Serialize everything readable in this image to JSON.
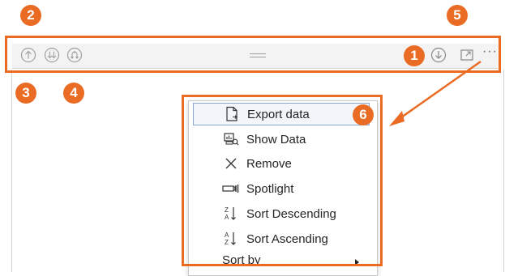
{
  "badges": [
    "1",
    "2",
    "3",
    "4",
    "5",
    "6"
  ],
  "toolbar": {
    "left_icons": [
      "arrow-up-icon",
      "double-arrow-down-icon",
      "branch-expand-icon"
    ],
    "center_icon": "drag-handle-icon",
    "right_icons": [
      "drill-down-icon",
      "focus-mode-icon",
      "more-options-icon"
    ],
    "more_label": "···"
  },
  "menu": {
    "items": [
      {
        "label": "Export data",
        "icon": "export-data-icon"
      },
      {
        "label": "Show Data",
        "icon": "show-data-icon"
      },
      {
        "label": "Remove",
        "icon": "remove-icon"
      },
      {
        "label": "Spotlight",
        "icon": "spotlight-icon"
      },
      {
        "label": "Sort Descending",
        "icon": "sort-descending-icon"
      },
      {
        "label": "Sort Ascending",
        "icon": "sort-ascending-icon"
      },
      {
        "label": "Sort by",
        "icon": "submenu-chevron-icon"
      }
    ]
  },
  "colors": {
    "annotation": "#ea6b24",
    "toolbar_bg": "#f3f3f3",
    "icon": "#a0a0a0",
    "text": "#252423"
  }
}
